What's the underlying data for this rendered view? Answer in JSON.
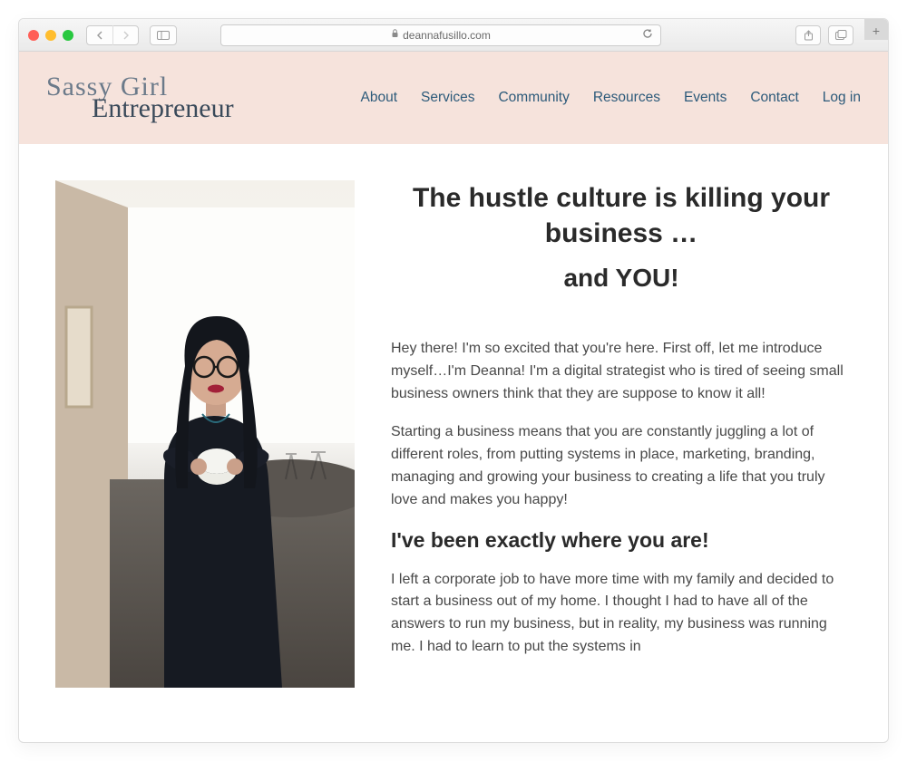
{
  "browser": {
    "url": "deannafusillo.com"
  },
  "logo": {
    "line1": "Sassy Girl",
    "line2": "Entrepreneur"
  },
  "nav": {
    "items": [
      "About",
      "Services",
      "Community",
      "Resources",
      "Events",
      "Contact",
      "Log in"
    ]
  },
  "content": {
    "headline1": "The hustle culture is killing your business …",
    "headline2": "and YOU!",
    "para1": "Hey there! I'm so excited that you're here. First off, let me introduce myself…I'm Deanna! I'm a digital strategist who is tired of seeing small business owners think that they are suppose to know it all!",
    "para2": "Starting a business means that you are constantly juggling a lot of different roles, from putting systems in place, marketing, branding, managing and growing your business to creating a life that you truly love and makes you happy!",
    "subhead": "I've been exactly where you are!",
    "para3": "I left a corporate job to have more time with my family and decided to start a business out of my home. I thought I had to have all of the answers to run my business, but in reality, my business was running me. I had to learn to put the systems in"
  },
  "image_alt": "Portrait of a woman with dark hair and glasses holding a mug, seated on a gray sofa in a bright cafe"
}
